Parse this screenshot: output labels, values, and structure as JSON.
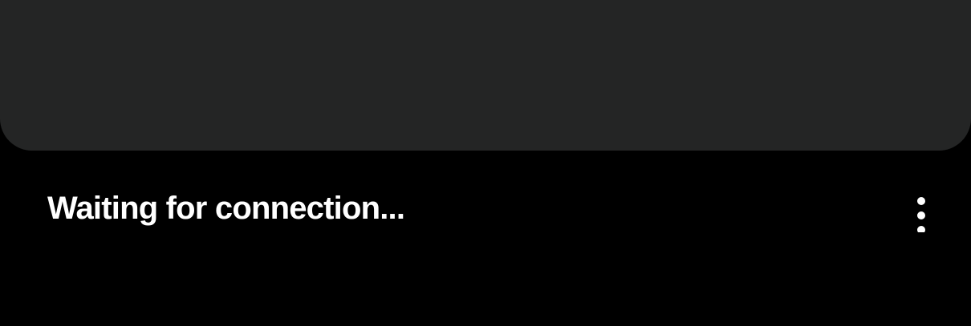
{
  "status": {
    "text": "Waiting for connection..."
  },
  "actions": {
    "more_icon": "more-vertical-icon"
  },
  "colors": {
    "background": "#000000",
    "panel": "#242525",
    "text": "#ffffff"
  }
}
